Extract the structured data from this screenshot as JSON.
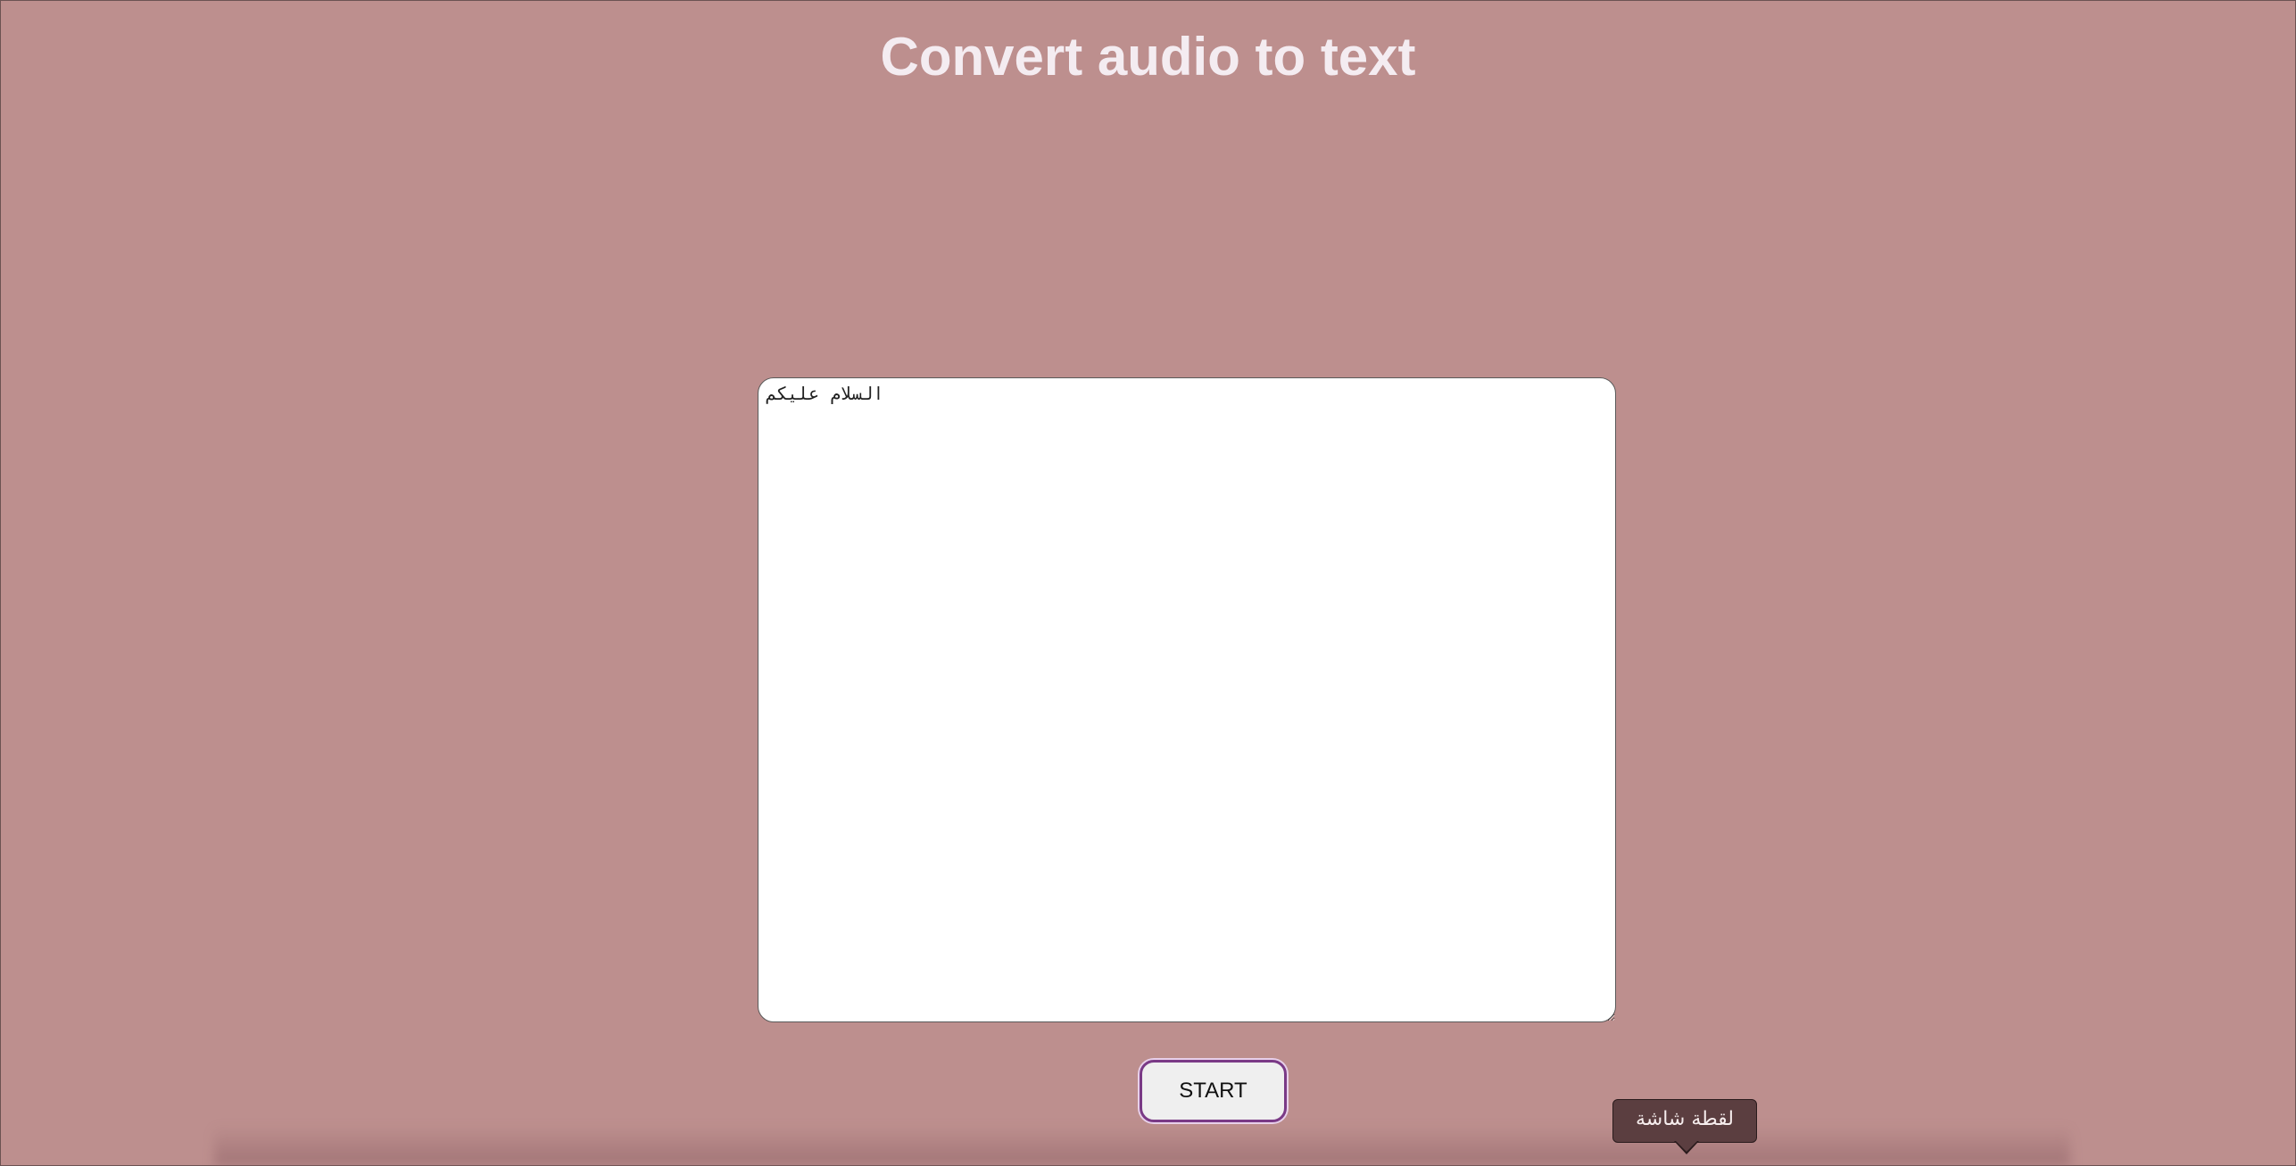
{
  "page": {
    "title": "Convert audio to text",
    "background_color": "#bd8f8e",
    "title_color": "#f4ecf1",
    "accent_color": "#7a3a86"
  },
  "transcript": {
    "value": "السلام عليكم"
  },
  "controls": {
    "start_label": "START"
  },
  "tooltip": {
    "text": "لقطة شاشة"
  }
}
